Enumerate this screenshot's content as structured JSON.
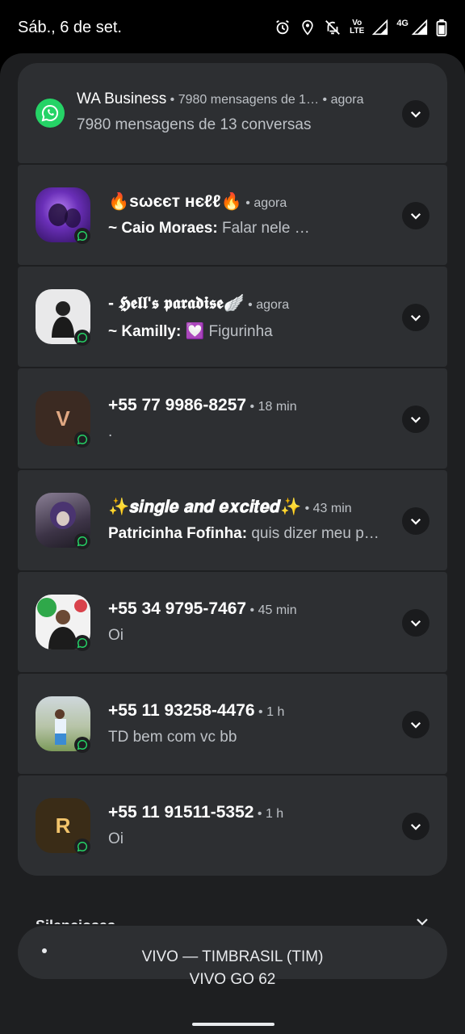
{
  "status_bar": {
    "date": "Sáb., 6 de set.",
    "icons": [
      "alarm-icon",
      "location-icon",
      "notifications-off-icon",
      "volte-icon",
      "signal-4g-icon",
      "signal-icon",
      "battery-icon"
    ],
    "volte_line1": "Vo",
    "volte_line2": "LTE",
    "network": "4G"
  },
  "notifications": [
    {
      "kind": "app",
      "title": "WA Business",
      "subtext": "7980 mensagens de 1…",
      "time": "agora",
      "text": "7980 mensagens de 13 conversas",
      "icon": "whatsapp-icon"
    },
    {
      "kind": "chat",
      "title": "🔥ѕωєєт нєℓℓ🔥",
      "time": "agora",
      "sender": "~ Caio Moraes:",
      "message": "Falar nele …",
      "avatar": "group-photo-purple"
    },
    {
      "kind": "chat",
      "title": "- 𝕳𝖊𝖑𝖑'𝖘 𝖕𝖆𝖗𝖆𝖉𝖎𝖘𝖊🪽",
      "time": "agora",
      "sender": "~ Kamilly:",
      "message": "💟 Figurinha",
      "avatar": "group-photo-girl"
    },
    {
      "kind": "chat",
      "title": "+55 77 9986-8257",
      "time": "18 min",
      "sender": "",
      "message": ".",
      "avatar_letter": "V"
    },
    {
      "kind": "chat",
      "title": "✨𝒔𝒊𝒏𝒈𝒍𝒆 𝒂𝒏𝒅 𝒆𝒙𝒄𝒊𝒕𝒆𝒅✨",
      "time": "43 min",
      "sender": "Patricinha Fofinha:",
      "message": "quis dizer meu p…",
      "avatar": "group-photo-dark"
    },
    {
      "kind": "chat",
      "title": "+55 34 9795-7467",
      "time": "45 min",
      "sender": "",
      "message": "Oi",
      "avatar": "contact-photo-boy"
    },
    {
      "kind": "chat",
      "title": "+55 11 93258-4476",
      "time": "1 h",
      "sender": "",
      "message": "TD bem com vc bb",
      "avatar": "contact-photo-field"
    },
    {
      "kind": "chat",
      "title": "+55 11 91511-5352",
      "time": "1 h",
      "sender": "",
      "message": "Oi",
      "avatar_letter": "R"
    }
  ],
  "silent_header": "Silenciosas",
  "carrier": {
    "line1": "VIVO — TIMBRASIL (TIM)",
    "line2": "VIVO GO 62"
  },
  "colors": {
    "shade": "#1e1f21",
    "card": "#2d2f32",
    "whatsapp_green": "#25d366",
    "letter_v_bg": "#3b2a22",
    "letter_v_fg": "#e0a883",
    "letter_r_bg": "#3a2c17",
    "letter_r_fg": "#f2c46b"
  }
}
